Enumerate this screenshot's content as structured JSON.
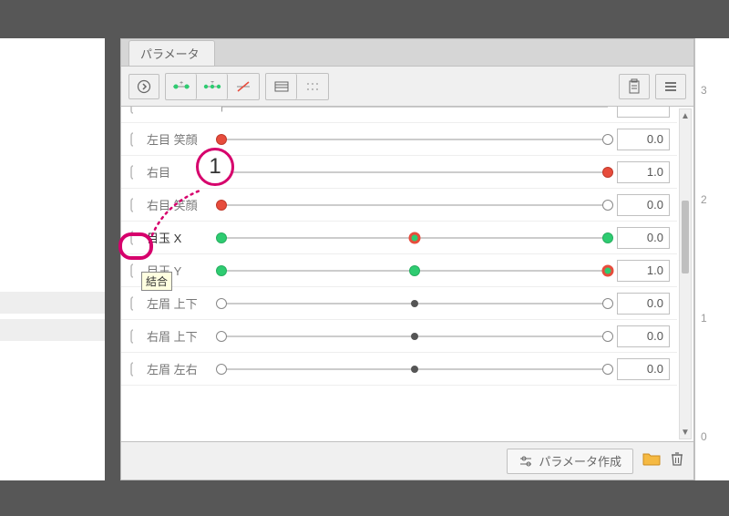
{
  "panel": {
    "tab_label": "パラメータ",
    "create_button_label": "パラメータ作成"
  },
  "tooltip": {
    "text": "結合"
  },
  "callout": {
    "number": "1"
  },
  "ruler": {
    "ticks": [
      "3",
      "2",
      "1",
      "0"
    ]
  },
  "rows": [
    {
      "label": "",
      "value": "",
      "keys": []
    },
    {
      "label": "左目 笑顔",
      "value": "0.0",
      "keys": [
        {
          "pos": 0,
          "kind": "full-red"
        },
        {
          "pos": 100,
          "kind": ""
        }
      ]
    },
    {
      "label": "右目",
      "value": "1.0",
      "keys": [
        {
          "pos": 0,
          "kind": ""
        },
        {
          "pos": 100,
          "kind": "full-red"
        }
      ]
    },
    {
      "label": "右目 笑顔",
      "value": "0.0",
      "keys": [
        {
          "pos": 0,
          "kind": "full-red"
        },
        {
          "pos": 100,
          "kind": ""
        }
      ]
    },
    {
      "label": "目玉 X",
      "value": "0.0",
      "keys": [
        {
          "pos": 0,
          "kind": "full-green"
        },
        {
          "pos": 50,
          "kind": "ring-red-green"
        },
        {
          "pos": 100,
          "kind": "full-green"
        }
      ],
      "selected": true
    },
    {
      "label": "目玉 Y",
      "value": "1.0",
      "keys": [
        {
          "pos": 0,
          "kind": "full-green"
        },
        {
          "pos": 50,
          "kind": "full-green"
        },
        {
          "pos": 100,
          "kind": "ring-red-green"
        }
      ]
    },
    {
      "label": "左眉 上下",
      "value": "0.0",
      "keys": [
        {
          "pos": 0
        },
        {
          "pos": 50,
          "kind": "dot-small"
        },
        {
          "pos": 100
        }
      ],
      "capped": true
    },
    {
      "label": "右眉 上下",
      "value": "0.0",
      "keys": [
        {
          "pos": 0
        },
        {
          "pos": 50,
          "kind": "dot-small"
        },
        {
          "pos": 100
        }
      ],
      "capped": true
    },
    {
      "label": "左眉 左右",
      "value": "0.0",
      "keys": [
        {
          "pos": 0
        },
        {
          "pos": 50,
          "kind": "dot-small"
        },
        {
          "pos": 100
        }
      ],
      "capped": true
    }
  ]
}
